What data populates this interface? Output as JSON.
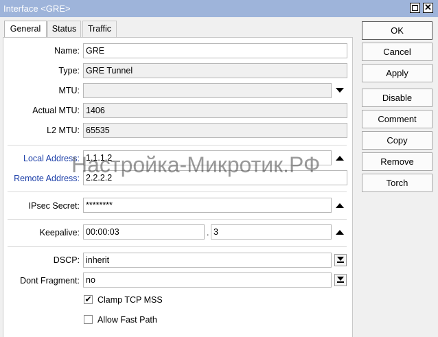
{
  "window": {
    "title": "Interface <GRE>"
  },
  "tabs": [
    "General",
    "Status",
    "Traffic"
  ],
  "form": {
    "name": {
      "label": "Name:",
      "value": "GRE"
    },
    "type": {
      "label": "Type:",
      "value": "GRE Tunnel"
    },
    "mtu": {
      "label": "MTU:",
      "value": ""
    },
    "actual_mtu": {
      "label": "Actual MTU:",
      "value": "1406"
    },
    "l2_mtu": {
      "label": "L2 MTU:",
      "value": "65535"
    },
    "local_address": {
      "label": "Local Address:",
      "value": "1.1.1.2"
    },
    "remote_address": {
      "label": "Remote Address:",
      "value": "2.2.2.2"
    },
    "ipsec_secret": {
      "label": "IPsec Secret:",
      "value": "********"
    },
    "keepalive": {
      "label": "Keepalive:",
      "value": "00:00:03",
      "separator": ".",
      "retries": "3"
    },
    "dscp": {
      "label": "DSCP:",
      "value": "inherit"
    },
    "dont_fragment": {
      "label": "Dont Fragment:",
      "value": "no"
    },
    "clamp_tcp_mss": {
      "label": "Clamp TCP MSS",
      "checked": true,
      "mark": "✔"
    },
    "allow_fast_path": {
      "label": "Allow Fast Path",
      "checked": false,
      "mark": ""
    }
  },
  "buttons": [
    "OK",
    "Cancel",
    "Apply",
    "Disable",
    "Comment",
    "Copy",
    "Remove",
    "Torch"
  ],
  "watermark": "Настройка-Микротик.РФ",
  "colors": {
    "titlebar": "#9eb4da",
    "link_label": "#1c3fa8"
  }
}
